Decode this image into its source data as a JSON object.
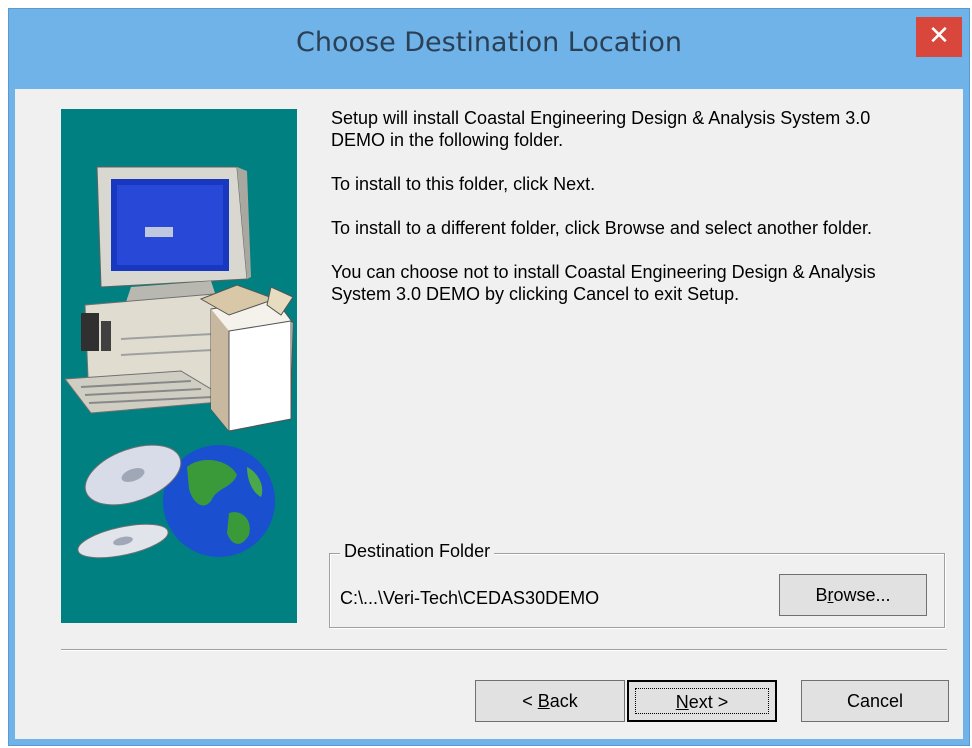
{
  "window": {
    "title": "Choose Destination Location",
    "close_glyph": "✕"
  },
  "body": {
    "paragraphs": [
      "Setup will install Coastal Engineering Design & Analysis System 3.0 DEMO in the following folder.",
      "To install to this folder, click Next.",
      "To install to a different folder, click Browse and select another folder.",
      "You can choose not to install Coastal Engineering Design & Analysis System 3.0 DEMO by clicking Cancel to exit Setup."
    ]
  },
  "destination": {
    "legend": "Destination Folder",
    "path": "C:\\...\\Veri-Tech\\CEDAS30DEMO",
    "browse_label_pre": "B",
    "browse_label_ul": "r",
    "browse_label_post": "owse..."
  },
  "buttons": {
    "back_pre": "< ",
    "back_ul": "B",
    "back_post": "ack",
    "next_ul": "N",
    "next_post": "ext >",
    "cancel": "Cancel"
  },
  "colors": {
    "title_bar": "#6fb3e8",
    "close_button": "#d9473c",
    "art_background": "#008080",
    "dialog_background": "#f0f0f0"
  },
  "icons": [
    "close-icon",
    "computer-icon",
    "cd-icon",
    "globe-icon",
    "box-icon"
  ]
}
